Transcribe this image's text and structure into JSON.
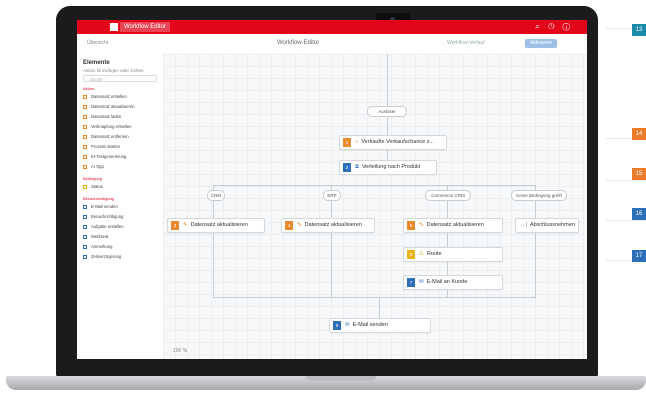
{
  "topbar": {
    "app_label": "Workflow Editor",
    "icons_text": "⌕ ◷ ⓘ"
  },
  "subbar": {
    "crumb": "Übersicht",
    "title": "Workflow-Editor",
    "links": "Workflow-Verlauf",
    "activate_button": "Aktivieren"
  },
  "sidebar": {
    "title": "Elemente",
    "subtitle": "Aktion hinzufügen oder ziehen",
    "search_placeholder": "Suche",
    "sections": [
      {
        "label": "Aktion",
        "items": [
          "Datensatz erstellen",
          "Datensatz aktualisieren",
          "Datensatz laden",
          "Verknüpfung erstellen",
          "Datensatz entfernen",
          "Prozess starten",
          "KI-Textgenerierung",
          "Ai Tipp"
        ]
      },
      {
        "label": "Bedingung",
        "items": [
          "Status"
        ]
      },
      {
        "label": "Benachrichtigung",
        "items": [
          "E-Mail senden",
          "Benachrichtigung",
          "Aufgabe erstellen",
          "Webhook",
          "Anmerkung",
          "Zeitverzögerung"
        ]
      }
    ]
  },
  "flow": {
    "start": "Auslöser",
    "n1": {
      "num": "1",
      "label": "Verkaufte Verkaufschance z..."
    },
    "n2": {
      "num": "2",
      "label": "Verteilung nach Produkt"
    },
    "branches": [
      "CRM",
      "ERP",
      "Commerce CRM",
      "Keine Bedingung greift"
    ],
    "n3": {
      "num": "3",
      "label": "Datensatz aktualisieren"
    },
    "n4": {
      "num": "4",
      "label": "Datensatz aktualisieren"
    },
    "n5": {
      "num": "5",
      "label": "Datensatz aktualisieren"
    },
    "n6": {
      "label": "Abschlussnehmen"
    },
    "n7": {
      "num": "6",
      "label": "Route"
    },
    "n8": {
      "num": "7",
      "label": "E-Mail an Kunde"
    },
    "n9": {
      "num": "8",
      "label": "E-Mail senden"
    }
  },
  "zoom": "100 %",
  "side_badges": [
    "13",
    "14",
    "15",
    "16",
    "17"
  ]
}
